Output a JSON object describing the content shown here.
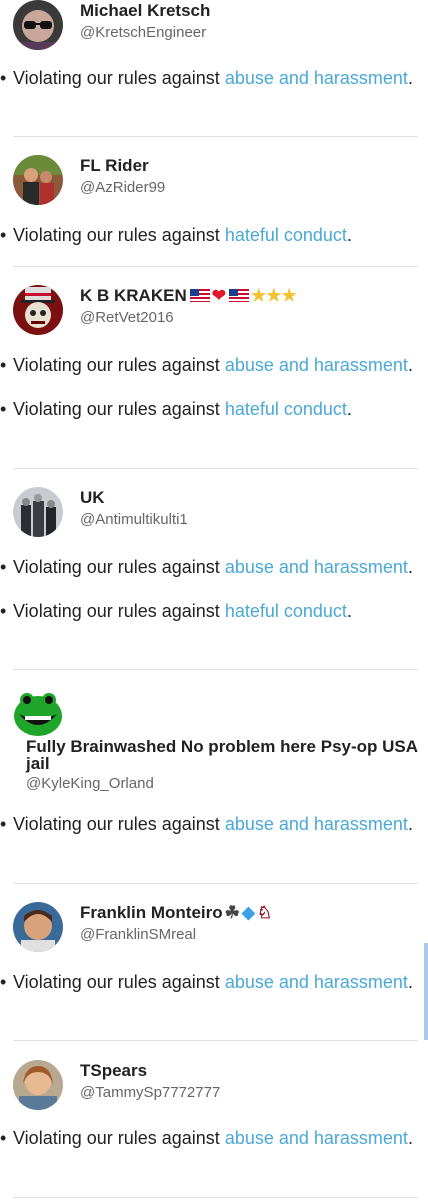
{
  "entries": [
    {
      "name": "Michael Kretsch",
      "handle": "@KretschEngineer",
      "rules": [
        {
          "prefix": "Violating our rules against ",
          "link": "abuse and harassment",
          "suffix": "."
        }
      ]
    },
    {
      "name": "FL Rider",
      "handle": "@AzRider99",
      "rules": [
        {
          "prefix": "Violating our rules against ",
          "link": "hateful conduct",
          "suffix": "."
        }
      ]
    },
    {
      "name": "K B KRAKEN",
      "handle": "@RetVet2016",
      "emoji": [
        "🇺🇸",
        "❤️",
        "🇺🇸",
        "⭐⭐⭐"
      ],
      "rules": [
        {
          "prefix": "Violating our rules against ",
          "link": "abuse and harassment",
          "suffix": "."
        },
        {
          "prefix": "Violating our rules against ",
          "link": "hateful conduct",
          "suffix": "."
        }
      ]
    },
    {
      "name": "UK",
      "handle": "@Antimultikulti1",
      "rules": [
        {
          "prefix": "Violating our rules against ",
          "link": "abuse and harassment",
          "suffix": "."
        },
        {
          "prefix": "Violating our rules against ",
          "link": "hateful conduct",
          "suffix": "."
        }
      ]
    },
    {
      "name": "Fully Brainwashed No problem here Psy-op USA jail",
      "handle": "@KyleKing_Orland",
      "rules": [
        {
          "prefix": "Violating our rules against ",
          "link": "abuse and harassment",
          "suffix": "."
        }
      ]
    },
    {
      "name": "Franklin Monteiro",
      "handle": "@FranklinSMreal",
      "emoji": [
        "🧙",
        "💎",
        "🍷"
      ],
      "rules": [
        {
          "prefix": "Violating our rules against ",
          "link": "abuse and harassment",
          "suffix": "."
        }
      ]
    },
    {
      "name": "TSpears",
      "handle": "@TammySp7772777",
      "rules": [
        {
          "prefix": "Violating our rules against ",
          "link": "abuse and harassment",
          "suffix": "."
        }
      ]
    }
  ],
  "bullet": "•",
  "colors": {
    "link": "#4aa8d8",
    "divider": "#e1e1e1",
    "handle": "#666666"
  }
}
